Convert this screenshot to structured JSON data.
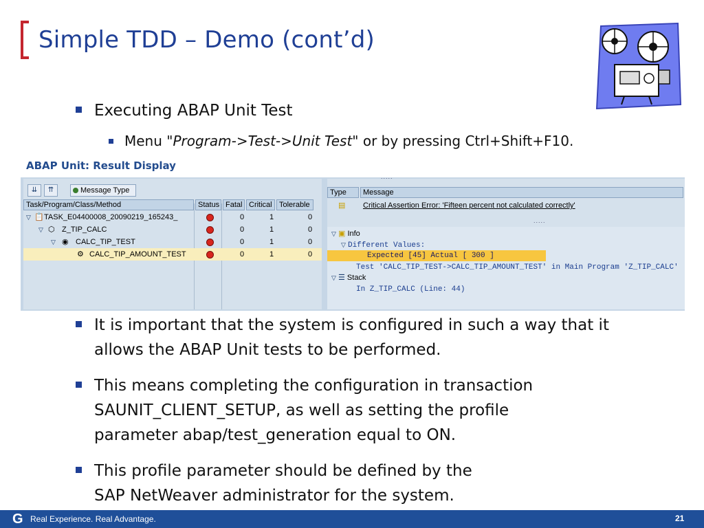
{
  "slide": {
    "title": "Simple TDD – Demo (cont’d)",
    "bullet1": "Executing ABAP Unit Test",
    "sub1_pre": "Menu \"",
    "sub1_italic": "Program->Test->Unit Test",
    "sub1_post": "\" or by pressing Ctrl+Shift+F10.",
    "bullet2_line1": "It is important that the system is configured in such a way that it",
    "bullet2_line2": "allows the ABAP Unit tests to be performed.",
    "bullet3_line1": "This means completing the configuration in transaction",
    "bullet3_line2": "SAUNIT_CLIENT_SETUP, as well as setting the profile",
    "bullet3_line3": "parameter abap/test_generation equal to ON.",
    "bullet4_line1": "This profile parameter should be defined by the",
    "bullet4_line2": "SAP NetWeaver administrator for the system."
  },
  "sap": {
    "window_title": "ABAP Unit: Result Display",
    "message_type_button": "Message Type",
    "tree_headers": [
      "Task/Program/Class/Method",
      "Status",
      "Fatal",
      "Critical",
      "Tolerable"
    ],
    "tree_rows": [
      {
        "name": "TASK_E04400008_20090219_165243_",
        "fatal": "0",
        "critical": "1",
        "tolerable": "0"
      },
      {
        "name": "Z_TIP_CALC",
        "fatal": "0",
        "critical": "1",
        "tolerable": "0"
      },
      {
        "name": "CALC_TIP_TEST",
        "fatal": "0",
        "critical": "1",
        "tolerable": "0"
      },
      {
        "name": "CALC_TIP_AMOUNT_TEST",
        "fatal": "0",
        "critical": "1",
        "tolerable": "0"
      }
    ],
    "msg_headers": [
      "Type",
      "Message"
    ],
    "msg_row": "Critical Assertion Error: 'Fifteen percent not calculated correctly'",
    "info_label": "Info",
    "diff_label": "Different Values:",
    "expected_line": "Expected [45] Actual [           300 ]",
    "test_line": "Test 'CALC_TIP_TEST->CALC_TIP_AMOUNT_TEST' in Main Program 'Z_TIP_CALC'",
    "stack_label": "Stack",
    "stack_line": "In Z_TIP_CALC (Line: 44)"
  },
  "footer": {
    "logo": "G",
    "tagline": "Real Experience. Real Advantage.",
    "page_number": "21"
  },
  "colors": {
    "title": "#1f3f95",
    "bracket": "#c4262e",
    "footer": "#1f4f99"
  }
}
